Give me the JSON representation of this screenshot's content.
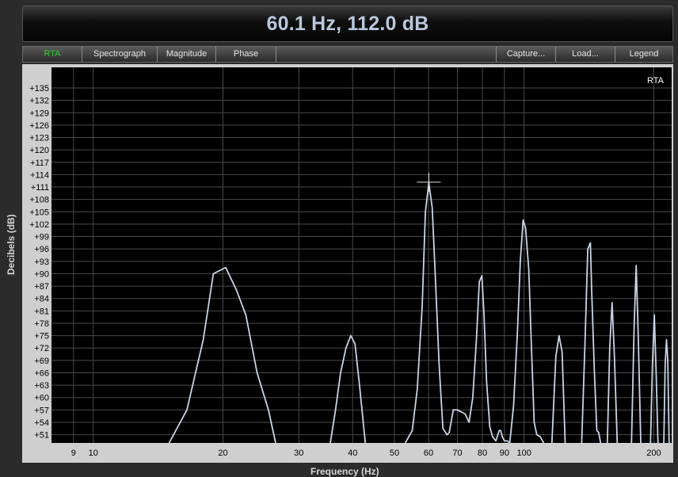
{
  "readout": {
    "text": "60.1 Hz, 112.0 dB"
  },
  "toolbar": {
    "left_tabs": [
      "RTA",
      "Spectrograph",
      "Magnitude",
      "Phase"
    ],
    "right_tabs": [
      "Capture...",
      "Load...",
      "Legend"
    ],
    "active": "RTA"
  },
  "colors": {
    "active_tab": "#2fd12f",
    "trace": "#c8d4e6",
    "grid": "#4a4a4a",
    "plot_bg": "#000000"
  },
  "chart_data": {
    "type": "line",
    "plot_label": "RTA",
    "xlabel": "Frequency (Hz)",
    "ylabel": "Decibels (dB)",
    "x_scale": "log",
    "xlim": [
      8,
      220
    ],
    "ylim": [
      49,
      140
    ],
    "x_ticks": [
      9,
      10,
      20,
      30,
      40,
      50,
      60,
      70,
      80,
      90,
      100,
      200
    ],
    "y_ticks": [
      51,
      54,
      57,
      60,
      63,
      66,
      69,
      72,
      75,
      78,
      81,
      84,
      87,
      90,
      93,
      96,
      99,
      102,
      105,
      108,
      111,
      114,
      117,
      120,
      123,
      126,
      129,
      132,
      135
    ],
    "cursor": {
      "x": 60.1,
      "y": 112.0
    },
    "series": [
      {
        "x": [
          15.0,
          16.5,
          18.0,
          19.0,
          20.3,
          21.5,
          22.6,
          24.0,
          25.5,
          26.5
        ],
        "y": [
          49,
          57,
          74,
          90,
          91.5,
          86,
          80,
          66,
          57,
          49
        ]
      },
      {
        "x": [
          35.5,
          36.5,
          37.5,
          38.6,
          39.6,
          40.5,
          41.5,
          42.8
        ],
        "y": [
          49,
          57,
          66,
          72,
          75,
          73,
          63,
          49
        ]
      },
      {
        "x": [
          53.0,
          55.0,
          56.5,
          58.0,
          59.0,
          60.1,
          61.2,
          62.3,
          63.5,
          64.8,
          66.2,
          67.0,
          68.5,
          70.0,
          71.5,
          73.0,
          74.5,
          76.0,
          77.5,
          78.7,
          79.8,
          80.7,
          81.8,
          83.2,
          84.5,
          86.0,
          87.5,
          88.2,
          89.0,
          90.0,
          91.5,
          92.6
        ],
        "y": [
          49,
          52,
          62,
          82,
          105,
          112,
          106,
          88,
          68,
          52.5,
          51,
          51.5,
          57,
          57,
          56.5,
          56,
          54,
          60,
          74,
          88,
          89.5,
          80,
          64,
          53,
          50.5,
          49.5,
          52,
          52,
          50.5,
          49.5,
          49.5,
          49
        ]
      },
      {
        "x": [
          92.6,
          94.5,
          96.5,
          98.0,
          99.5,
          100.8,
          102.5,
          104.0,
          105.5,
          107.0,
          109.0,
          111.0
        ],
        "y": [
          49,
          58,
          76,
          93,
          103,
          101,
          91,
          72,
          54,
          51,
          50.5,
          49
        ]
      },
      {
        "x": [
          116.0,
          118.5,
          120.5,
          122.5,
          124.5
        ],
        "y": [
          49,
          70,
          75,
          71,
          49
        ]
      },
      {
        "x": [
          136.0,
          138.5,
          140.5,
          142.5,
          143.5,
          145.5,
          147.5,
          149.0,
          150.5
        ],
        "y": [
          49,
          74,
          96,
          97.5,
          86,
          67,
          52,
          51.5,
          49
        ]
      },
      {
        "x": [
          156.0,
          158.0,
          160.0,
          162.0,
          164.5
        ],
        "y": [
          49,
          72,
          83,
          70,
          49
        ]
      },
      {
        "x": [
          177.5,
          180.0,
          182.0,
          184.0,
          186.5
        ],
        "y": [
          49,
          77,
          92,
          75,
          49
        ]
      },
      {
        "x": [
          196.5,
          198.5,
          200.5,
          202.5,
          204.5
        ],
        "y": [
          49,
          68,
          80,
          66,
          49
        ]
      },
      {
        "x": [
          211.0,
          212.5,
          214.0,
          215.5,
          217.0
        ],
        "y": [
          49,
          68,
          74,
          69,
          49
        ]
      }
    ]
  }
}
